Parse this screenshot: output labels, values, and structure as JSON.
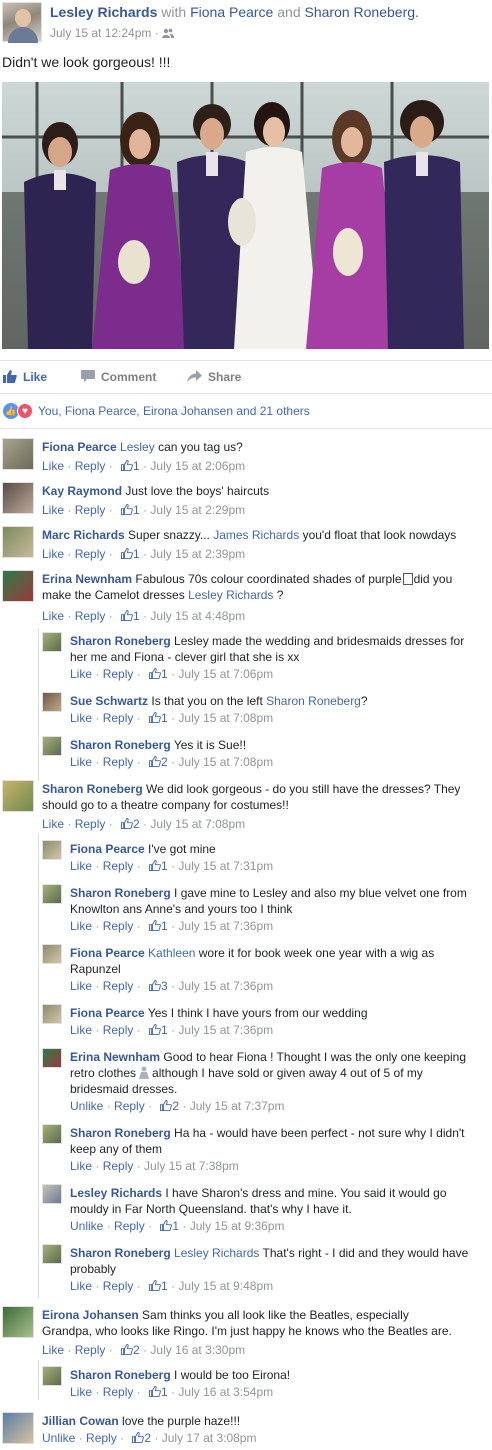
{
  "post": {
    "author": "Lesley Richards",
    "with_word": "with",
    "tag1": "Fiona Pearce",
    "and_word": "and",
    "tag2": "Sharon Roneberg.",
    "timestamp": "July 15 at 12:24pm",
    "audience_icon": "friends-icon",
    "text": "Didn't we look gorgeous! !!!"
  },
  "actions": {
    "like": "Like",
    "comment": "Comment",
    "share": "Share"
  },
  "reactions": {
    "summary": "You, Fiona Pearce, Eirona Johansen and 21 others"
  },
  "colors": {
    "link": "#365899",
    "action_blue": "#4267b2",
    "meta_grey": "#90949c"
  },
  "comments": [
    {
      "author": "Fiona Pearce",
      "tag": "Lesley",
      "text": " can you tag us?",
      "like": "Like",
      "reply": "Reply",
      "likes": "1",
      "time": "July 15 at 2:06pm"
    },
    {
      "author": "Kay Raymond",
      "text": "Just love the boys' haircuts",
      "like": "Like",
      "reply": "Reply",
      "likes": "1",
      "time": "July 15 at 2:29pm"
    },
    {
      "author": "Marc Richards",
      "text": "Super snazzy... ",
      "tag": "James Richards",
      "text2": " you'd float that look nowdays",
      "like": "Like",
      "reply": "Reply",
      "likes": "1",
      "time": "July 15 at 2:39pm"
    },
    {
      "author": "Erina Newnham",
      "text": "Fabulous 70s colour coordinated shades of purple",
      "text2": "did you make the Camelot dresses ",
      "tag": "Lesley Richards",
      "text3": " ?",
      "like": "Like",
      "reply": "Reply",
      "likes": "1",
      "time": "July 15 at 4:48pm"
    },
    {
      "author": "Sharon Roneberg",
      "text": "Lesley made the wedding and bridesmaids dresses for her me and Fiona - clever girl that she is xx",
      "like": "Like",
      "reply": "Reply",
      "likes": "1",
      "time": "July 15 at 7:06pm"
    },
    {
      "author": "Sue Schwartz",
      "text": "Is that you on the left ",
      "tag": "Sharon Roneberg",
      "text2": "?",
      "like": "Like",
      "reply": "Reply",
      "likes": "1",
      "time": "July 15 at 7:08pm"
    },
    {
      "author": "Sharon Roneberg",
      "text": "Yes it is Sue!!",
      "like": "Like",
      "reply": "Reply",
      "likes": "2",
      "time": "July 15 at 7:08pm"
    },
    {
      "author": "Sharon Roneberg",
      "text": "We did look gorgeous - do you still have the dresses? They should go to a theatre company for costumes!!",
      "like": "Like",
      "reply": "Reply",
      "likes": "2",
      "time": "July 15 at 7:08pm"
    },
    {
      "author": "Fiona Pearce",
      "text": "I've got mine",
      "like": "Like",
      "reply": "Reply",
      "likes": "1",
      "time": "July 15 at 7:31pm"
    },
    {
      "author": "Sharon Roneberg",
      "text": "I gave mine to Lesley and also my blue velvet one from Knowlton ans Anne's and yours too I think",
      "like": "Like",
      "reply": "Reply",
      "likes": "1",
      "time": "July 15 at 7:36pm"
    },
    {
      "author": "Fiona Pearce",
      "tag": "Kathleen",
      "text": " wore it for book week one year with a wig as Rapunzel",
      "like": "Like",
      "reply": "Reply",
      "likes": "3",
      "time": "July 15 at 7:36pm"
    },
    {
      "author": "Fiona Pearce",
      "text": "Yes I think I have yours from our wedding",
      "like": "Like",
      "reply": "Reply",
      "likes": "1",
      "time": "July 15 at 7:36pm"
    },
    {
      "author": "Erina Newnham",
      "text": "Good to hear Fiona ! Thought I was the only one keeping retro clothes",
      "text2": "although I have sold or given away 4 out of 5 of my bridesmaid dresses.",
      "like": "Unlike",
      "reply": "Reply",
      "likes": "2",
      "time": "July 15 at 7:37pm"
    },
    {
      "author": "Sharon Roneberg",
      "text": "Ha ha - would have been perfect - not sure why I didn't keep any of them",
      "like": "Like",
      "reply": "Reply",
      "time": "July 15 at 7:38pm"
    },
    {
      "author": "Lesley Richards",
      "text": "I have Sharon's dress and mine. You said it would go mouldy in Far North Queensland. that's why I have it.",
      "like": "Unlike",
      "reply": "Reply",
      "likes": "1",
      "time": "July 15 at 9:36pm"
    },
    {
      "author": "Sharon Roneberg",
      "tag": "Lesley Richards",
      "text": " That's right - I did and they would have probably",
      "like": "Like",
      "reply": "Reply",
      "likes": "1",
      "time": "July 15 at 9:48pm"
    },
    {
      "author": "Eirona Johansen",
      "text": "Sam thinks you all look like the Beatles, especially Grandpa, who looks like Ringo. I'm just happy he knows who the Beatles are.",
      "like": "Like",
      "reply": "Reply",
      "likes": "2",
      "time": "July 16 at 3:30pm"
    },
    {
      "author": "Sharon Roneberg",
      "text": "I would be too Eirona!",
      "like": "Like",
      "reply": "Reply",
      "likes": "1",
      "time": "July 16 at 3:54pm"
    },
    {
      "author": "Jillian Cowan",
      "text": "love the purple haze!!!",
      "like": "Unlike",
      "reply": "Reply",
      "likes": "2",
      "time": "July 17 at 3:08pm"
    }
  ]
}
